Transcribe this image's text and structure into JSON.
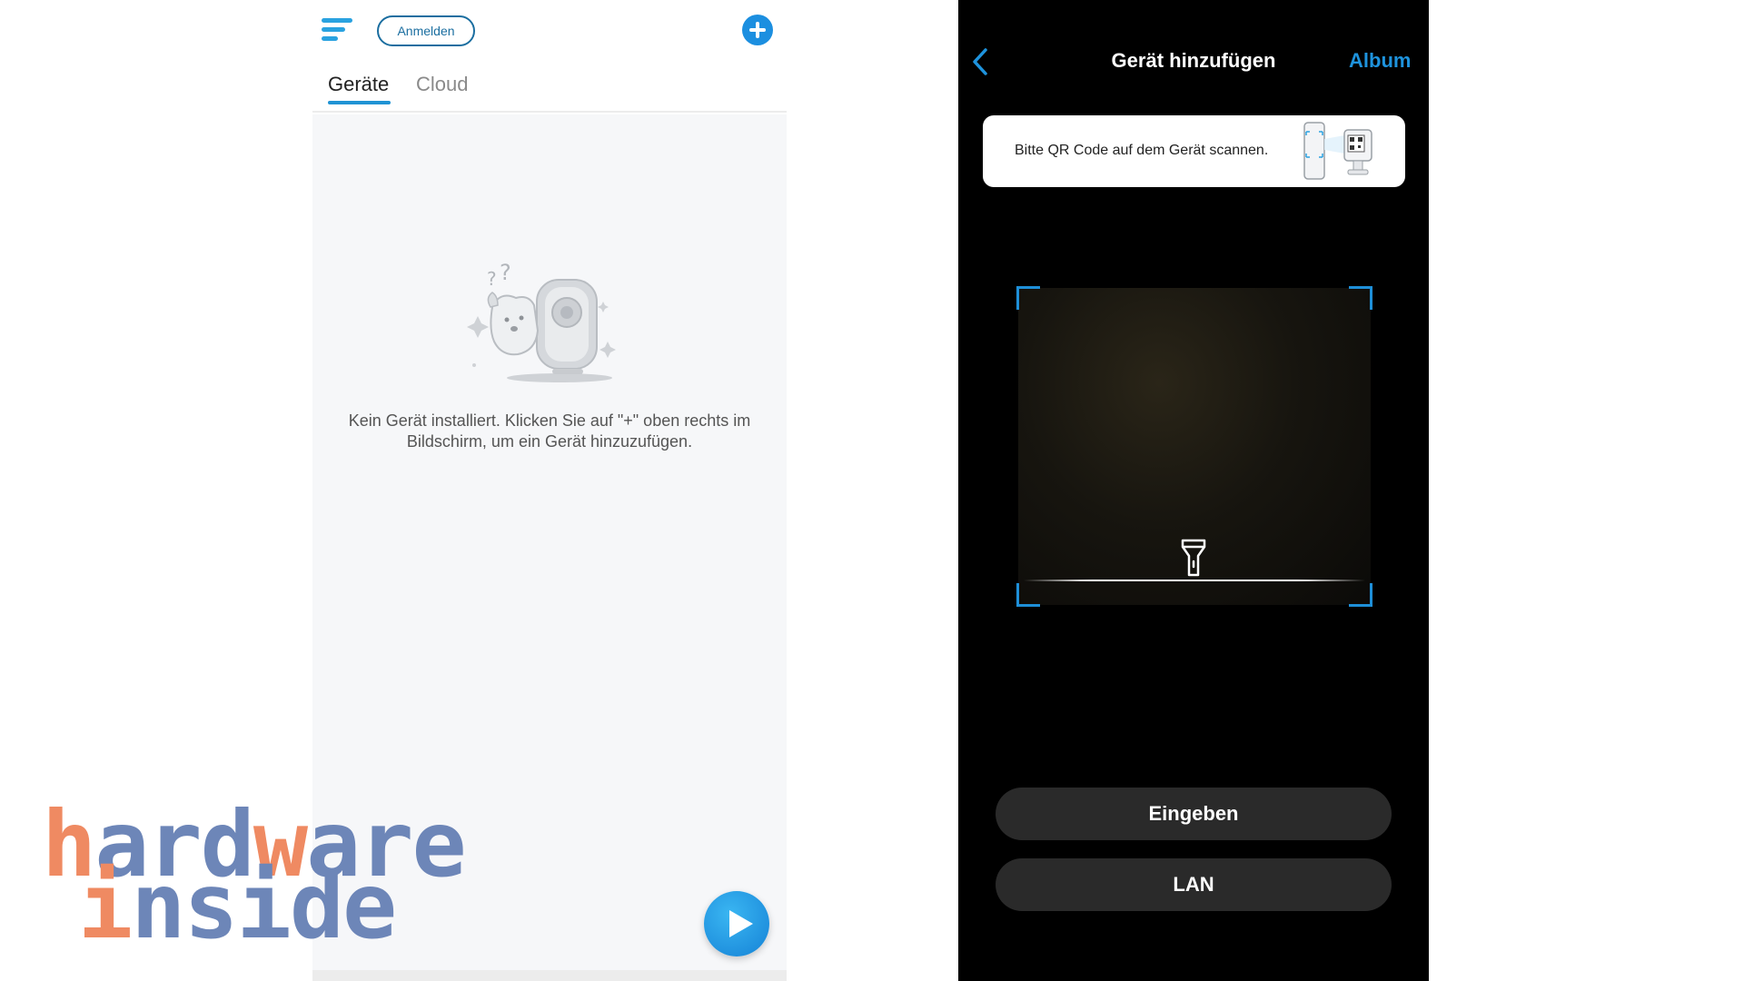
{
  "left_app": {
    "header": {
      "login_label": "Anmelden"
    },
    "tabs": [
      {
        "label": "Geräte",
        "active": true
      },
      {
        "label": "Cloud",
        "active": false
      }
    ],
    "empty_state": {
      "message": "Kein Gerät installiert. Klicken Sie auf \"+\" oben rechts im Bildschirm, um ein Gerät hinzuzufügen."
    },
    "colors": {
      "accent": "#1f93d4",
      "background": "#f6f7f9"
    },
    "icons": {
      "menu": "menu-icon",
      "add": "plus-circle-icon",
      "play": "play-icon"
    }
  },
  "watermark": {
    "word1": "hardware",
    "word2": "inside",
    "colors": {
      "orange": "#ef8a62",
      "blue": "#6d86b8"
    }
  },
  "right_app": {
    "header": {
      "title": "Gerät hinzufügen",
      "album_label": "Album"
    },
    "hint": {
      "text": "Bitte QR Code auf dem Gerät scannen."
    },
    "buttons": {
      "enter_label": "Eingeben",
      "lan_label": "LAN"
    },
    "colors": {
      "accent": "#1e93dd",
      "background": "#000000",
      "button_bg": "#2a2a2a"
    },
    "icons": {
      "back": "chevron-left-icon",
      "torch": "flashlight-icon"
    }
  }
}
